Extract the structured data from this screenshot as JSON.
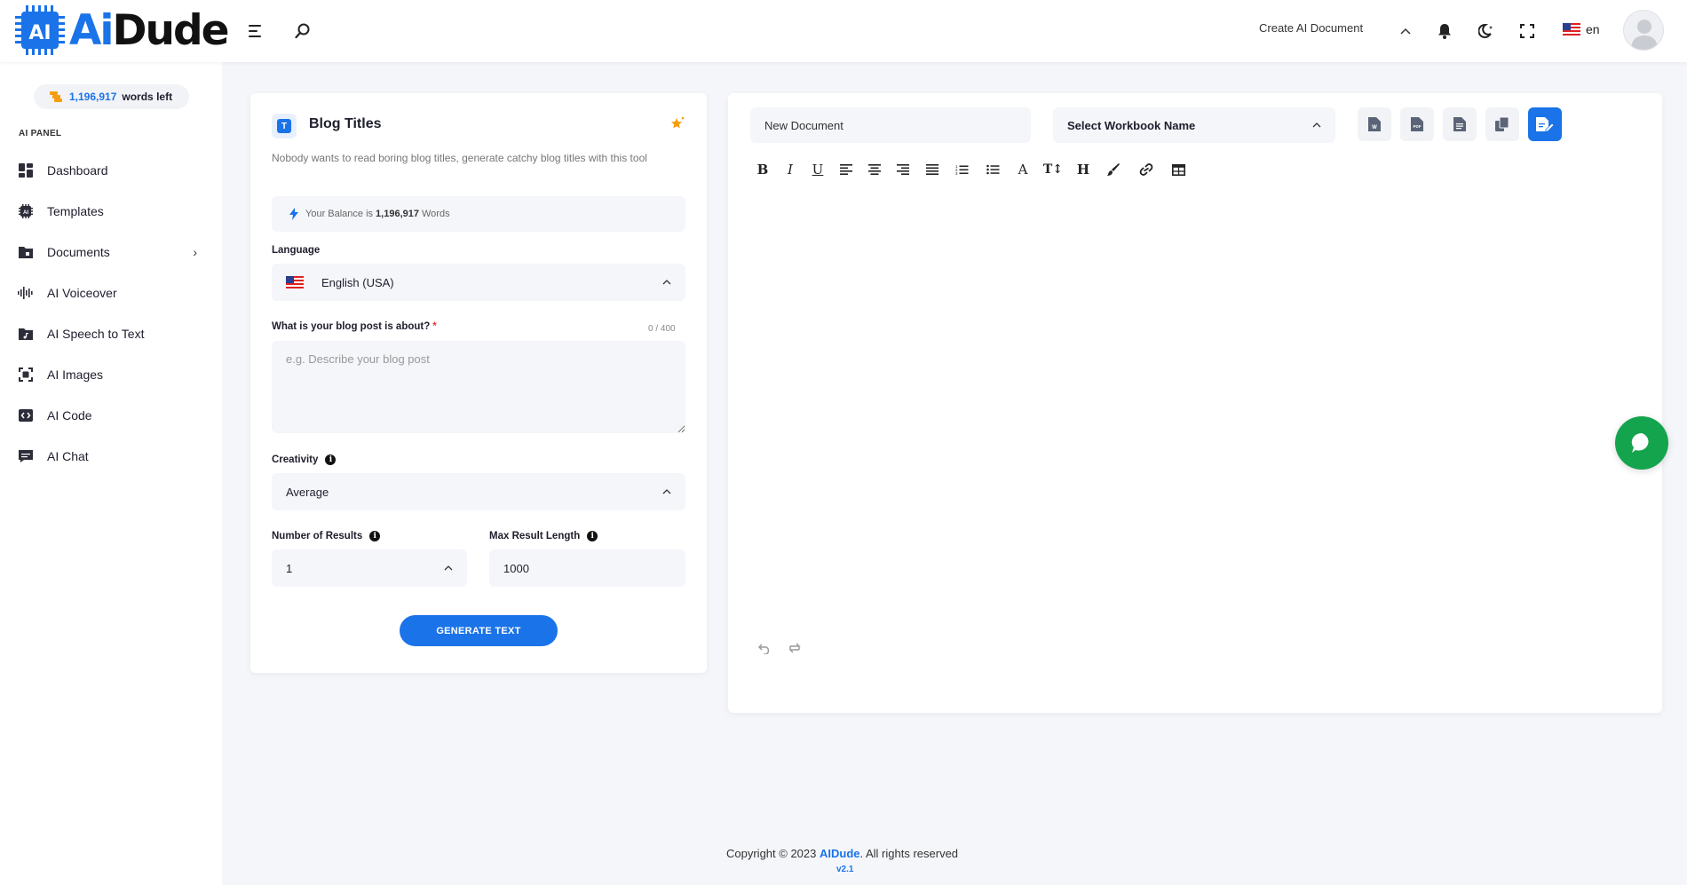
{
  "brand": {
    "logo_ai": "Ai",
    "logo_dude": "Dude",
    "chip_text": "AI"
  },
  "header": {
    "create_doc_label": "Create AI Document",
    "language_code": "en"
  },
  "sidebar": {
    "words_count": "1,196,917",
    "words_suffix": "words left",
    "panel_label": "AI PANEL",
    "items": [
      {
        "label": "Dashboard",
        "icon": "dashboard-icon"
      },
      {
        "label": "Templates",
        "icon": "chip-icon"
      },
      {
        "label": "Documents",
        "icon": "folder-icon"
      },
      {
        "label": "AI Voiceover",
        "icon": "waveform-icon"
      },
      {
        "label": "AI Speech to Text",
        "icon": "music-file-icon"
      },
      {
        "label": "AI Images",
        "icon": "image-scan-icon"
      },
      {
        "label": "AI Code",
        "icon": "code-icon"
      },
      {
        "label": "AI Chat",
        "icon": "chat-icon"
      }
    ]
  },
  "tool": {
    "badge": "T",
    "title": "Blog Titles",
    "description": "Nobody wants to read boring blog titles, generate catchy blog titles with this tool",
    "balance_prefix": "Your Balance is",
    "balance_value": "1,196,917",
    "balance_suffix": "Words",
    "language_label": "Language",
    "language_value": "English (USA)",
    "about_label": "What is your blog post is about?",
    "about_required": "*",
    "about_counter": "0 / 400",
    "about_placeholder": "e.g. Describe your blog post",
    "creativity_label": "Creativity",
    "creativity_value": "Average",
    "results_label": "Number of Results",
    "results_value": "1",
    "max_length_label": "Max Result Length",
    "max_length_value": "1000",
    "generate_label": "GENERATE TEXT"
  },
  "editor": {
    "doc_name": "New Document",
    "workbook_placeholder": "Select Workbook Name",
    "export_buttons": [
      "word-export-icon",
      "pdf-export-icon",
      "text-export-icon",
      "copy-icon",
      "save-document-icon"
    ]
  },
  "footer": {
    "copyright_prefix": "Copyright © 2023",
    "brand": "AIDude",
    "copyright_suffix": ". All rights reserved",
    "version": "v2.1"
  },
  "colors": {
    "accent": "#1a73e8",
    "chat": "#14a44d",
    "star": "#f59e0b"
  }
}
